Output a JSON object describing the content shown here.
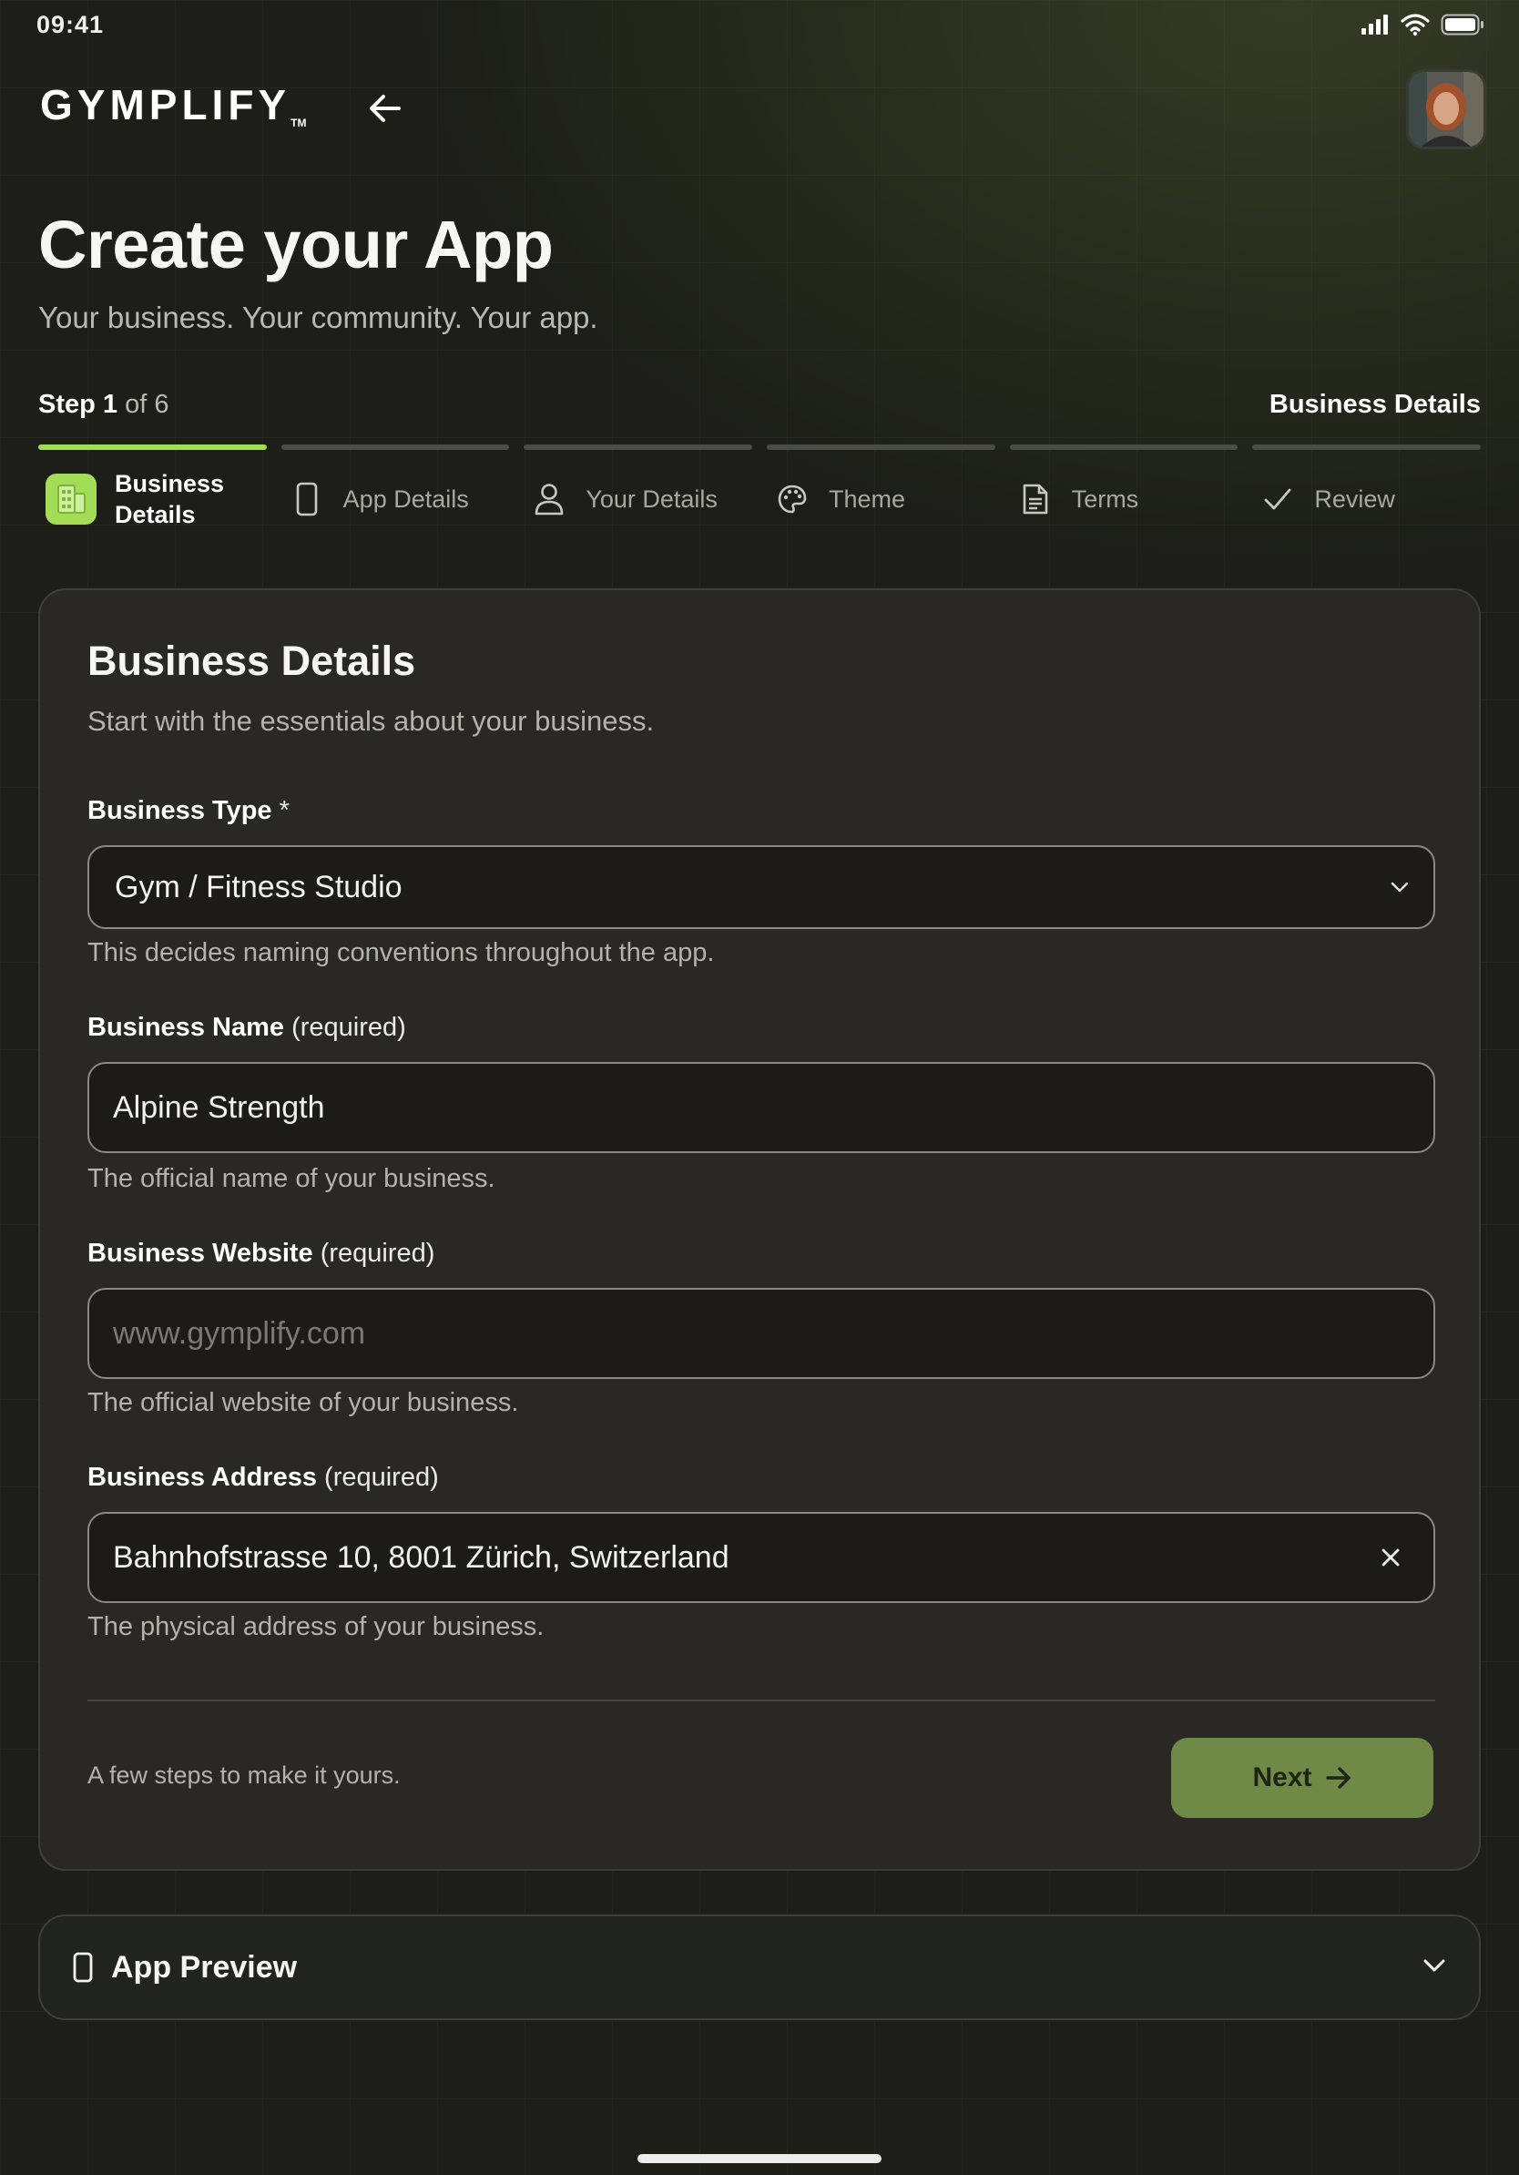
{
  "status": {
    "time": "09:41"
  },
  "header": {
    "logo": "GYMPLIFY",
    "logo_tm": "TM"
  },
  "page": {
    "title": "Create your App",
    "subtitle": "Your business. Your community. Your app."
  },
  "progress": {
    "step_word": "Step",
    "step_number": "1",
    "step_of": "of 6",
    "current_step_name": "Business Details",
    "total_segments": 6,
    "active_segment": 1
  },
  "steps": [
    {
      "label": "Business Details",
      "icon": "building-icon",
      "active": true
    },
    {
      "label": "App Details",
      "icon": "phone-icon",
      "active": false
    },
    {
      "label": "Your Details",
      "icon": "user-icon",
      "active": false
    },
    {
      "label": "Theme",
      "icon": "palette-icon",
      "active": false
    },
    {
      "label": "Terms",
      "icon": "document-icon",
      "active": false
    },
    {
      "label": "Review",
      "icon": "check-icon",
      "active": false
    }
  ],
  "form": {
    "title": "Business Details",
    "subtitle": "Start with the essentials about your business.",
    "business_type": {
      "label": "Business Type",
      "required_mark": "*",
      "value": "Gym / Fitness Studio",
      "hint": "This decides naming conventions throughout the app."
    },
    "business_name": {
      "label": "Business Name",
      "suffix": "(required)",
      "value": "Alpine Strength",
      "hint": "The official name of your business."
    },
    "business_website": {
      "label": "Business Website",
      "suffix": "(required)",
      "placeholder": "www.gymplify.com",
      "hint": "The official website of your business."
    },
    "business_address": {
      "label": "Business Address",
      "suffix": "(required)",
      "value": "Bahnhofstrasse 10, 8001 Zürich, Switzerland",
      "hint": "The physical address of your business."
    },
    "footer_text": "A few steps to make it yours.",
    "next_label": "Next"
  },
  "preview": {
    "label": "App Preview"
  },
  "colors": {
    "accent": "#a3dc57",
    "button": "#6e8a46",
    "background": "#1c1e17",
    "card": "#2a2926"
  }
}
